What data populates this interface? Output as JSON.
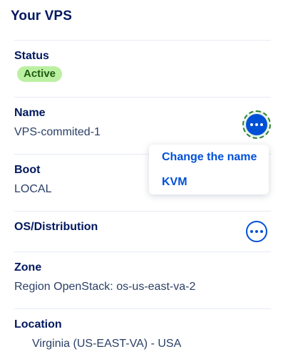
{
  "panel": {
    "title": "Your VPS"
  },
  "rows": {
    "status": {
      "label": "Status",
      "value": "Active"
    },
    "name": {
      "label": "Name",
      "value": "VPS-commited-1"
    },
    "boot": {
      "label": "Boot",
      "value": "LOCAL"
    },
    "os": {
      "label": "OS/Distribution"
    },
    "zone": {
      "label": "Zone",
      "value": "Region OpenStack: os-us-east-va-2"
    },
    "location": {
      "label": "Location",
      "value": "Virginia (US-EAST-VA) - USA"
    }
  },
  "menu": {
    "items": [
      {
        "label": "Change the name"
      },
      {
        "label": "KVM"
      }
    ]
  },
  "icons": {
    "actions": "ellipsis-icon",
    "location": "flag-icon"
  },
  "colors": {
    "accent": "#0050d7",
    "title": "#00185e",
    "badge_bg": "#bbf0a2",
    "badge_text": "#1d5b0f",
    "focus_ring": "#2e7d32"
  }
}
